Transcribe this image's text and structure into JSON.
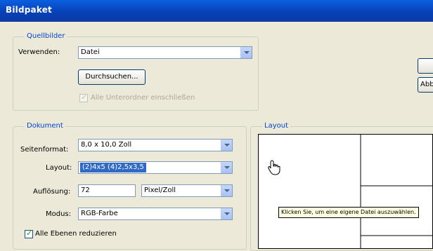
{
  "window": {
    "title": "Bildpaket"
  },
  "source": {
    "legend": "Quellbilder",
    "use_label": "Verwenden:",
    "use_value": "Datei",
    "browse_label": "Durchsuchen...",
    "subfolders_label": "Alle Unterordner einschließen",
    "subfolders_checked": true,
    "subfolders_enabled": false
  },
  "document": {
    "legend": "Dokument",
    "page_size_label": "Seitenformat:",
    "page_size_value": "8,0 x 10,0 Zoll",
    "layout_label": "Layout:",
    "layout_value": "(2)4x5 (4)2,5x3,5",
    "resolution_label": "Auflösung:",
    "resolution_value": "72",
    "resolution_unit": "Pixel/Zoll",
    "mode_label": "Modus:",
    "mode_value": "RGB-Farbe",
    "flatten_label": "Alle Ebenen reduzieren",
    "flatten_checked": true
  },
  "preview": {
    "legend": "Layout",
    "tooltip": "Klicken Sie, um eine eigene Datei auszuwählen."
  },
  "buttons": {
    "cancel_label": "Abb"
  },
  "icons": {
    "cursor": "hand-pointer-icon",
    "dropdown": "chevron-down-icon"
  },
  "colors": {
    "title_bar": "#0a46cf",
    "legend_text": "#0046d5",
    "selection": "#316ac5",
    "dialog_bg": "#ece9d8"
  }
}
